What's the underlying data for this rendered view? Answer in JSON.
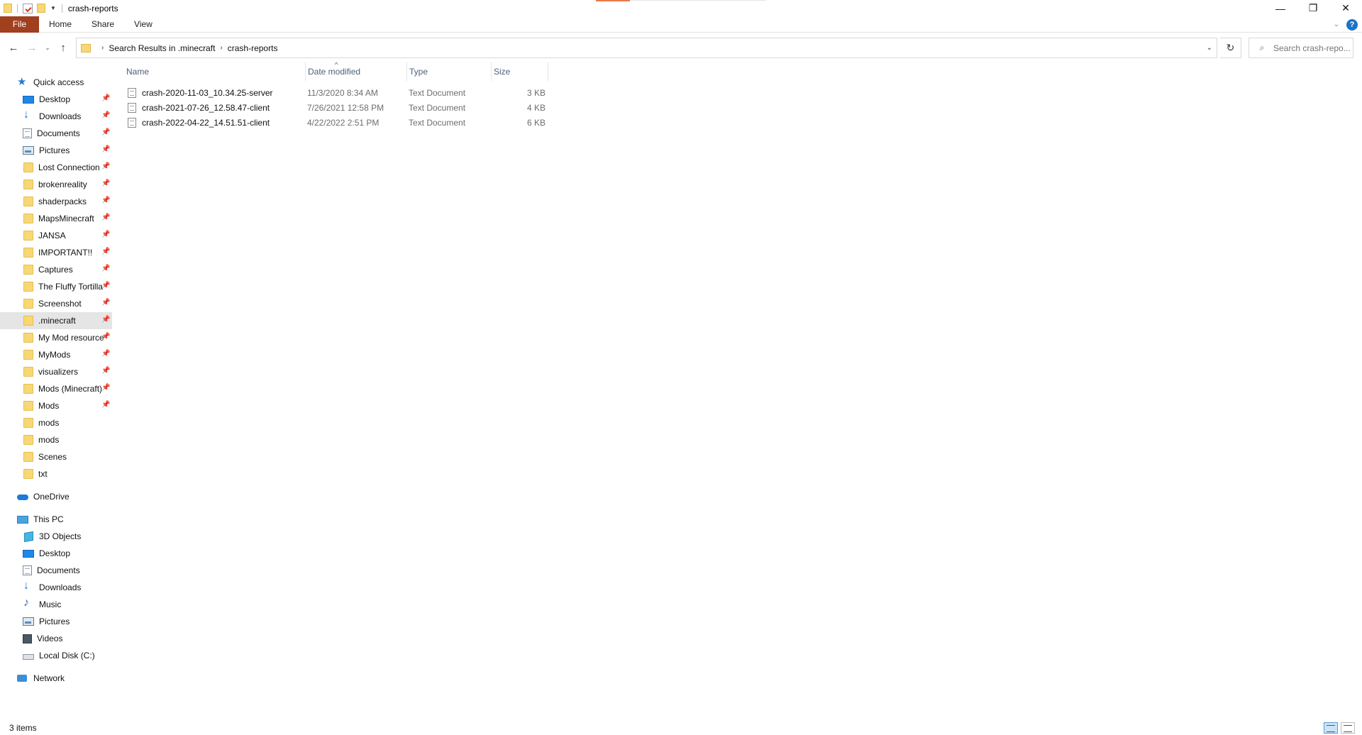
{
  "window": {
    "title": "crash-reports"
  },
  "ribbon": {
    "tabs": [
      "File",
      "Home",
      "Share",
      "View"
    ]
  },
  "address": {
    "crumbs": [
      "Search Results in .minecraft",
      "crash-reports"
    ]
  },
  "search": {
    "placeholder": "Search crash-repo..."
  },
  "sidebar": {
    "quick_access": "Quick access",
    "quick_items": [
      {
        "label": "Desktop",
        "icon": "desktop-icon",
        "pinned": true
      },
      {
        "label": "Downloads",
        "icon": "downloads-icon",
        "pinned": true
      },
      {
        "label": "Documents",
        "icon": "documents-icon",
        "pinned": true
      },
      {
        "label": "Pictures",
        "icon": "pictures-icon",
        "pinned": true
      },
      {
        "label": "Lost Connection",
        "icon": "folder-icon",
        "pinned": true
      },
      {
        "label": "brokenreality",
        "icon": "folder-icon",
        "pinned": true
      },
      {
        "label": "shaderpacks",
        "icon": "folder-icon",
        "pinned": true
      },
      {
        "label": "MapsMinecraft",
        "icon": "folder-icon",
        "pinned": true
      },
      {
        "label": "JANSA",
        "icon": "folder-icon",
        "pinned": true
      },
      {
        "label": "IMPORTANT!!",
        "icon": "folder-icon",
        "pinned": true
      },
      {
        "label": "Captures",
        "icon": "folder-icon",
        "pinned": true
      },
      {
        "label": "The Fluffy Tortilla",
        "icon": "folder-icon",
        "pinned": true
      },
      {
        "label": "Screenshot",
        "icon": "folder-icon",
        "pinned": true
      },
      {
        "label": ".minecraft",
        "icon": "folder-icon",
        "pinned": true,
        "selected": true
      },
      {
        "label": "My Mod resources",
        "icon": "folder-icon",
        "pinned": true
      },
      {
        "label": "MyMods",
        "icon": "folder-icon",
        "pinned": true
      },
      {
        "label": "visualizers",
        "icon": "folder-icon",
        "pinned": true
      },
      {
        "label": "Mods (Minecraft)",
        "icon": "folder-icon",
        "pinned": true
      },
      {
        "label": "Mods",
        "icon": "folder-icon",
        "pinned": true
      },
      {
        "label": "mods",
        "icon": "folder-icon",
        "pinned": false
      },
      {
        "label": "mods",
        "icon": "folder-icon",
        "pinned": false
      },
      {
        "label": "Scenes",
        "icon": "folder-icon",
        "pinned": false
      },
      {
        "label": "txt",
        "icon": "folder-icon",
        "pinned": false
      }
    ],
    "onedrive": "OneDrive",
    "this_pc": "This PC",
    "pc_items": [
      {
        "label": "3D Objects",
        "icon": "3d-objects-icon"
      },
      {
        "label": "Desktop",
        "icon": "desktop-icon"
      },
      {
        "label": "Documents",
        "icon": "documents-icon"
      },
      {
        "label": "Downloads",
        "icon": "downloads-icon"
      },
      {
        "label": "Music",
        "icon": "music-icon"
      },
      {
        "label": "Pictures",
        "icon": "pictures-icon"
      },
      {
        "label": "Videos",
        "icon": "videos-icon"
      },
      {
        "label": "Local Disk (C:)",
        "icon": "local-disk-icon"
      }
    ],
    "network": "Network"
  },
  "columns": [
    "Name",
    "Date modified",
    "Type",
    "Size"
  ],
  "files": [
    {
      "name": "crash-2020-11-03_10.34.25-server",
      "date": "11/3/2020 8:34 AM",
      "type": "Text Document",
      "size": "3 KB"
    },
    {
      "name": "crash-2021-07-26_12.58.47-client",
      "date": "7/26/2021 12:58 PM",
      "type": "Text Document",
      "size": "4 KB"
    },
    {
      "name": "crash-2022-04-22_14.51.51-client",
      "date": "4/22/2022 2:51 PM",
      "type": "Text Document",
      "size": "6 KB"
    }
  ],
  "status": {
    "item_count": "3 items"
  },
  "colors": {
    "file_tab": "#a0401e",
    "selection": "#e5e5e5",
    "folder": "#f8d775",
    "header_text": "#4c607a"
  }
}
